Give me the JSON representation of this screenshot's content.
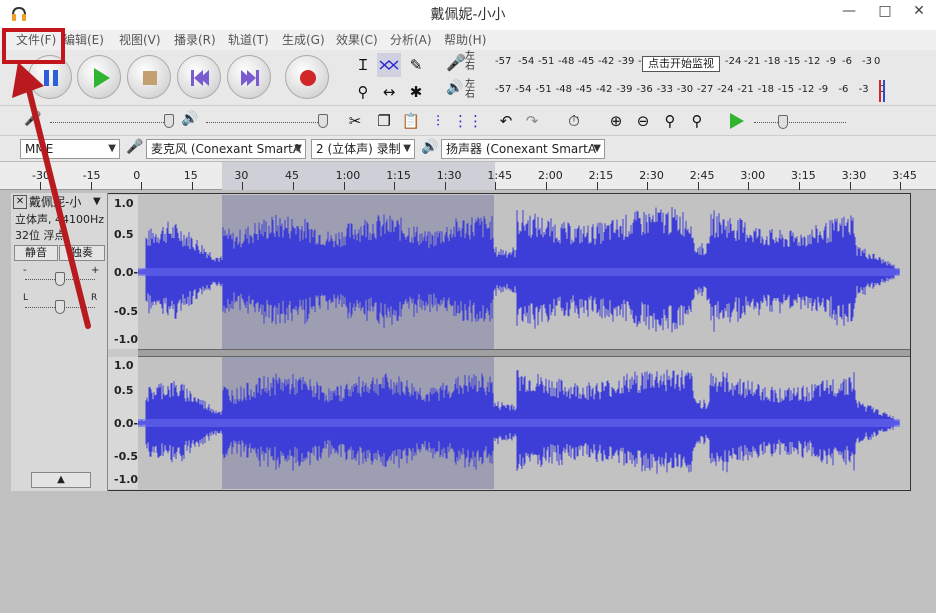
{
  "window": {
    "title": "戴佩妮-小小",
    "minimize": "—",
    "maximize": "□",
    "close": "✕"
  },
  "menu": [
    "文件(F)",
    "编辑(E)",
    "视图(V)",
    "播录(R)",
    "轨道(T)",
    "生成(G)",
    "效果(C)",
    "分析(A)",
    "帮助(H)"
  ],
  "meter": {
    "record_label": "左右",
    "play_label": "左右",
    "record_scale": [
      "-57",
      "-54",
      "-51",
      "-48",
      "-45",
      "-42",
      "-39",
      "-3",
      "-24",
      "-21",
      "-18",
      "-15",
      "-12",
      "-9",
      "-6",
      "-3",
      "0"
    ],
    "play_scale": [
      "-57",
      "-54",
      "-51",
      "-48",
      "-45",
      "-42",
      "-39",
      "-36",
      "-33",
      "-30",
      "-27",
      "-24",
      "-21",
      "-18",
      "-15",
      "-12",
      "-9",
      "-6",
      "-3",
      "0"
    ],
    "monitor_tip": "点击开始监视"
  },
  "devices": {
    "host": "MME",
    "mic": "麦克风 (Conexant SmartA",
    "channels": "2 (立体声) 录制",
    "speaker": "扬声器 (Conexant SmartA"
  },
  "ruler": [
    "-30",
    "-15",
    "0",
    "15",
    "30",
    "45",
    "1:00",
    "1:15",
    "1:30",
    "1:45",
    "2:00",
    "2:15",
    "2:30",
    "2:45",
    "3:00",
    "3:15",
    "3:30",
    "3:45"
  ],
  "track": {
    "name": "戴佩妮-小",
    "info1": "立体声, 44100Hz",
    "info2": "32位 浮点",
    "mute": "静音",
    "solo": "独奏",
    "close": "✕",
    "menu": "▼",
    "collapse": "▲",
    "gain_minus": "-",
    "gain_plus": "+",
    "pan_left": "L",
    "pan_right": "R"
  },
  "amp_labels": [
    "1.0",
    "0.5",
    "0.0-",
    "-0.5",
    "-1.0"
  ],
  "amp_labels2": [
    "1.0",
    "0.5",
    "0.0-",
    "-0.5",
    "-1.0"
  ],
  "colors": {
    "wave": "#3d3dd8",
    "selection": "#9e9eb2",
    "highlight": "#c2161c"
  }
}
